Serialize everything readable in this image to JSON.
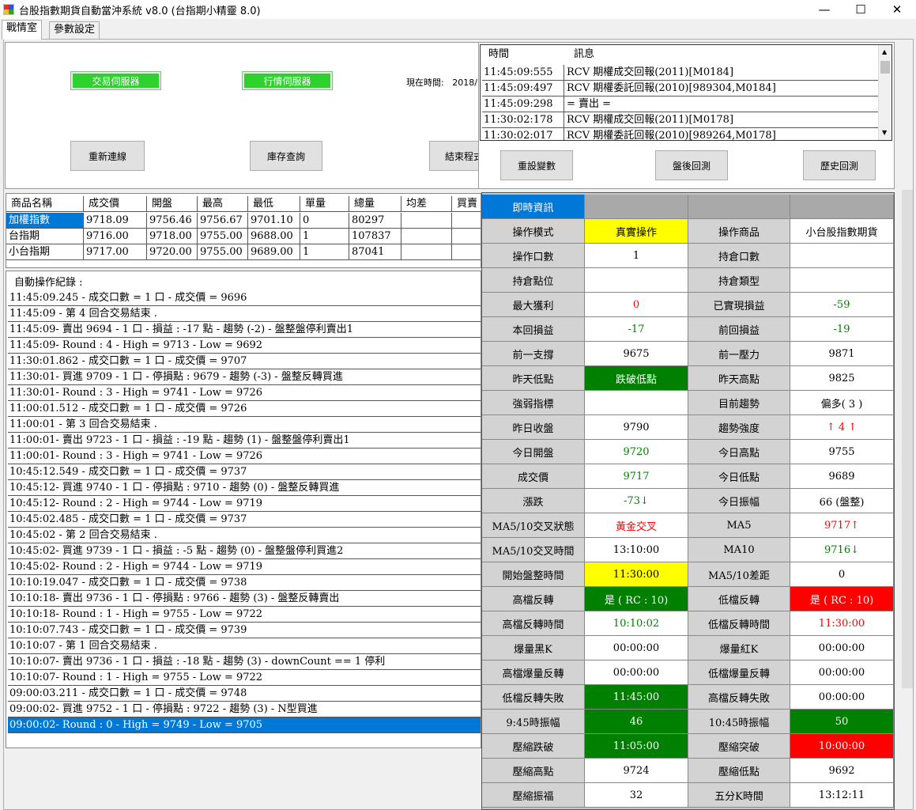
{
  "window": {
    "title": "台股指數期貨自動當沖系統 v8.0 (台指期小精靈 8.0)",
    "minimize": "—",
    "maximize": "☐",
    "close": "✕"
  },
  "tabs": [
    "戰情室",
    "參數設定"
  ],
  "connection": {
    "trade_server": "交易伺服器",
    "quote_server": "行情伺服器",
    "current_time_label": "現在時間:",
    "current_time_value": "2018/",
    "reconnect": "重新連線",
    "inventory": "庫存查詢",
    "exit": "結束程式"
  },
  "actions": {
    "reset_vars": "重設變數",
    "after_backtest": "盤後回測",
    "history_backtest": "歷史回測"
  },
  "messages": {
    "headers": [
      "時間",
      "訊息"
    ],
    "rows": [
      {
        "time": "11:45:09:555",
        "text": "RCV 期權成交回報(2011)[M0184]"
      },
      {
        "time": "11:45:09:497",
        "text": "RCV 期權委託回報(2010)[989304,M0184]"
      },
      {
        "time": "11:45:09:298",
        "text": "= 賣出 ="
      },
      {
        "time": "11:30:02:178",
        "text": "RCV 期權成交回報(2011)[M0178]"
      },
      {
        "time": "11:30:02:017",
        "text": "RCV 期權委託回報(2010)[989264,M0178]"
      }
    ]
  },
  "quotes": {
    "headers": [
      "商品名稱",
      "成交價",
      "開盤",
      "最高",
      "最低",
      "單量",
      "總量",
      "均差",
      "買賣"
    ],
    "rows": [
      [
        "加權指數",
        "9718.09",
        "9756.46",
        "9756.67",
        "9701.10",
        "0",
        "80297",
        "",
        ""
      ],
      [
        "台指期",
        "9716.00",
        "9718.00",
        "9755.00",
        "9688.00",
        "1",
        "107837",
        "",
        ""
      ],
      [
        "小台指期",
        "9717.00",
        "9720.00",
        "9755.00",
        "9689.00",
        "1",
        "87041",
        "",
        ""
      ]
    ]
  },
  "log": {
    "title": "自動操作紀錄 :",
    "rows": [
      "11:45:09.245 - 成交口數 = 1 口 - 成交價 = 9696",
      "11:45:09 - 第 4 回合交易結束 .",
      "11:45:09- 賣出 9694 - 1 口 - 損益 : -17 點 - 趨勢 (-2) - 盤整盤停利賣出1",
      "11:45:09- Round : 4 - High = 9713 - Low = 9692",
      "11:30:01.862 - 成交口數 = 1 口 - 成交價 = 9707",
      "11:30:01- 買進 9709 - 1 口 - 停損點 : 9679 - 趨勢 (-3) - 盤整反轉買進",
      "11:30:01- Round : 3 - High = 9741 - Low = 9726",
      "11:00:01.512 - 成交口數 = 1 口 - 成交價 = 9726",
      "11:00:01 - 第 3 回合交易結束 .",
      "11:00:01- 賣出 9723 - 1 口 - 損益 : -19 點 - 趨勢 (1) - 盤整盤停利賣出1",
      "11:00:01- Round : 3 - High = 9741 - Low = 9726",
      "10:45:12.549 - 成交口數 = 1 口 - 成交價 = 9737",
      "10:45:12- 買進 9740 - 1 口 - 停損點 : 9710 - 趨勢 (0) - 盤整反轉買進",
      "10:45:12- Round : 2 - High = 9744 - Low = 9719",
      "10:45:02.485 - 成交口數 = 1 口 - 成交價 = 9737",
      "10:45:02 - 第 2 回合交易結束 .",
      "10:45:02- 買進 9739 - 1 口 - 損益 : -5 點 - 趨勢 (0) - 盤整盤停利買進2",
      "10:45:02- Round : 2 - High = 9744 - Low = 9719",
      "10:10:19.047 - 成交口數 = 1 口 - 成交價 = 9738",
      "10:10:18- 賣出 9736 - 1 口 - 停損點 : 9766 - 趨勢 (3) - 盤整反轉賣出",
      "10:10:18- Round : 1 - High = 9755 - Low = 9722",
      "10:10:07.743 - 成交口數 = 1 口 - 成交價 = 9739",
      "10:10:07 - 第 1 回合交易結束 .",
      "10:10:07- 賣出 9736 - 1 口 - 損益 : -18 點 - 趨勢 (3) - downCount == 1 停利",
      "10:10:07- Round : 1 - High = 9755 - Low = 9722",
      "09:00:03.211 - 成交口數 = 1 口 - 成交價 = 9748",
      "09:00:02- 買進 9752 - 1 口 - 停損點 : 9722 - 趨勢 (3) - N型買進",
      "09:00:02- Round : 0 - High = 9749 - Low = 9705"
    ]
  },
  "info": {
    "header": "即時資訊",
    "rows": [
      [
        {
          "t": "操作模式"
        },
        {
          "t": "真實操作",
          "bg": "yellow"
        },
        {
          "t": "操作商品"
        },
        {
          "t": "小台股指數期貨"
        }
      ],
      [
        {
          "t": "操作口數"
        },
        {
          "t": "1"
        },
        {
          "t": "持倉口數"
        },
        {
          "t": ""
        }
      ],
      [
        {
          "t": "持倉點位"
        },
        {
          "t": ""
        },
        {
          "t": "持倉類型"
        },
        {
          "t": ""
        }
      ],
      [
        {
          "t": "最大獲利"
        },
        {
          "t": "0",
          "c": "red"
        },
        {
          "t": "已實現損益"
        },
        {
          "t": "-59",
          "c": "green"
        }
      ],
      [
        {
          "t": "本回損益"
        },
        {
          "t": "-17",
          "c": "green"
        },
        {
          "t": "前回損益"
        },
        {
          "t": "-19",
          "c": "green"
        }
      ],
      [
        {
          "t": "前一支撐"
        },
        {
          "t": "9675"
        },
        {
          "t": "前一壓力"
        },
        {
          "t": "9871"
        }
      ],
      [
        {
          "t": "昨天低點"
        },
        {
          "t": "跌破低點",
          "bg": "green"
        },
        {
          "t": "昨天高點"
        },
        {
          "t": "9825"
        }
      ],
      [
        {
          "t": "強弱指標"
        },
        {
          "t": ""
        },
        {
          "t": "目前趨勢"
        },
        {
          "t": "偏多( 3 )"
        }
      ],
      [
        {
          "t": "昨日收盤"
        },
        {
          "t": "9790"
        },
        {
          "t": "趨勢強度"
        },
        {
          "t": "↑ 4 ↑",
          "c": "red"
        }
      ],
      [
        {
          "t": "今日開盤"
        },
        {
          "t": "9720",
          "c": "green"
        },
        {
          "t": "今日高點"
        },
        {
          "t": "9755"
        }
      ],
      [
        {
          "t": "成交價"
        },
        {
          "t": "9717",
          "c": "green"
        },
        {
          "t": "今日低點"
        },
        {
          "t": "9689"
        }
      ],
      [
        {
          "t": "漲跌"
        },
        {
          "t": "-73↓",
          "c": "green"
        },
        {
          "t": "今日振幅"
        },
        {
          "t": "66 (盤整)"
        }
      ],
      [
        {
          "t": "MA5/10交叉狀態"
        },
        {
          "t": "黃金交叉",
          "c": "red"
        },
        {
          "t": "MA5"
        },
        {
          "t": "9717↑",
          "c": "red"
        }
      ],
      [
        {
          "t": "MA5/10交叉時間"
        },
        {
          "t": "13:10:00"
        },
        {
          "t": "MA10"
        },
        {
          "t": "9716↓",
          "c": "green"
        }
      ],
      [
        {
          "t": "開始盤整時間"
        },
        {
          "t": "11:30:00",
          "bg": "yellow"
        },
        {
          "t": "MA5/10差距"
        },
        {
          "t": "0"
        }
      ],
      [
        {
          "t": "高檔反轉"
        },
        {
          "t": "是 ( RC : 10)",
          "bg": "green"
        },
        {
          "t": "低檔反轉"
        },
        {
          "t": "是 ( RC : 10)",
          "bg": "red"
        }
      ],
      [
        {
          "t": "高檔反轉時間"
        },
        {
          "t": "10:10:02",
          "c": "green"
        },
        {
          "t": "低檔反轉時間"
        },
        {
          "t": "11:30:00",
          "c": "red"
        }
      ],
      [
        {
          "t": "爆量黑K"
        },
        {
          "t": "00:00:00"
        },
        {
          "t": "爆量紅K"
        },
        {
          "t": "00:00:00"
        }
      ],
      [
        {
          "t": "高檔爆量反轉"
        },
        {
          "t": "00:00:00"
        },
        {
          "t": "低檔爆量反轉"
        },
        {
          "t": "00:00:00"
        }
      ],
      [
        {
          "t": "低檔反轉失敗"
        },
        {
          "t": "11:45:00",
          "bg": "green"
        },
        {
          "t": "高檔反轉失敗"
        },
        {
          "t": "00:00:00"
        }
      ],
      [
        {
          "t": "9:45時振幅"
        },
        {
          "t": "46",
          "bg": "green"
        },
        {
          "t": "10:45時振幅"
        },
        {
          "t": "50",
          "bg": "green"
        }
      ],
      [
        {
          "t": "壓縮跌破"
        },
        {
          "t": "11:05:00",
          "bg": "green"
        },
        {
          "t": "壓縮突破"
        },
        {
          "t": "10:00:00",
          "bg": "red"
        }
      ],
      [
        {
          "t": "壓縮高點"
        },
        {
          "t": "9724"
        },
        {
          "t": "壓縮低點"
        },
        {
          "t": "9692"
        }
      ],
      [
        {
          "t": "壓縮振福"
        },
        {
          "t": "32"
        },
        {
          "t": "五分K時間"
        },
        {
          "t": "13:12:11"
        }
      ]
    ]
  },
  "colors": {
    "selection": "#0078d7",
    "green_button": "#2ed12e",
    "red": "#ff0000",
    "green": "#008000",
    "yellow": "#ffff00"
  }
}
